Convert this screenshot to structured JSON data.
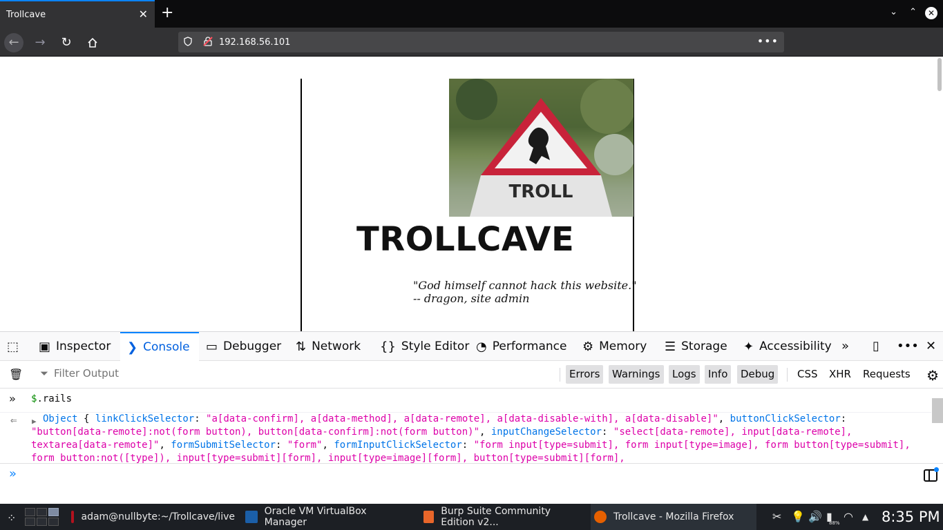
{
  "browser": {
    "tab_title": "Trollcave",
    "tab_close": "✕",
    "new_tab": "+",
    "url": "192.168.56.101",
    "url_more": "•••"
  },
  "page": {
    "site_title": "TROLLCAVE",
    "sign_text": "TROLL",
    "quote_line1": "\"God himself cannot hack this website.\"",
    "quote_line2": "-- dragon, site admin"
  },
  "devtools": {
    "tabs": [
      {
        "label": "Inspector"
      },
      {
        "label": "Console"
      },
      {
        "label": "Debugger"
      },
      {
        "label": "Network"
      },
      {
        "label": "Style Editor"
      },
      {
        "label": "Performance"
      },
      {
        "label": "Memory"
      },
      {
        "label": "Storage"
      },
      {
        "label": "Accessibility"
      }
    ],
    "filter_placeholder": "Filter Output",
    "filters": {
      "errors": "Errors",
      "warnings": "Warnings",
      "logs": "Logs",
      "info": "Info",
      "debug": "Debug",
      "css": "CSS",
      "xhr": "XHR",
      "requests": "Requests"
    },
    "console": {
      "command": ".rails",
      "command_prefix": "$",
      "result": {
        "object_label": "Object",
        "open_brace": "{",
        "k1": "linkClickSelector",
        "v1": "\"a[data-confirm], a[data-method], a[data-remote], a[data-disable-with], a[data-disable]\"",
        "k2": "buttonClickSelector",
        "v2": "\"button[data-remote]:not(form button), button[data-confirm]:not(form button)\"",
        "k3": "inputChangeSelector",
        "v3": "\"select[data-remote], input[data-remote], textarea[data-remote]\"",
        "k4": "formSubmitSelector",
        "v4": "\"form\"",
        "k5": "formInputClickSelector",
        "v5": "\"form input[type=submit], form input[type=image], form button[type=submit], form button:not([type]), input[type=submit][form], input[type=image][form], button[type=submit][form],"
      }
    }
  },
  "taskbar": {
    "tasks": [
      {
        "label": "adam@nullbyte:~/Trollcave/live"
      },
      {
        "label": "Oracle VM VirtualBox Manager"
      },
      {
        "label": "Burp Suite Community Edition v2..."
      },
      {
        "label": "Trollcave - Mozilla Firefox"
      }
    ],
    "battery": "88%",
    "clock": "8:35 PM"
  }
}
